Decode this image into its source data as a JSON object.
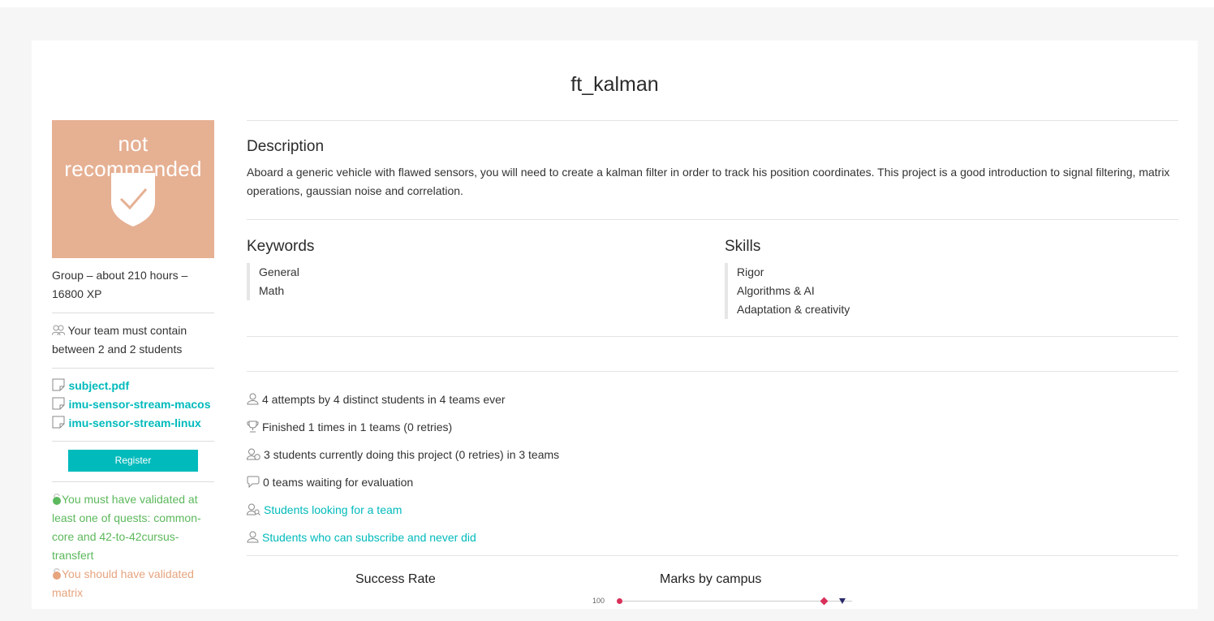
{
  "project": {
    "title": "ft_kalman",
    "badge_label": "not recommended",
    "meta": "Group – about 210 hours – 16800 XP",
    "team_text": "Your team must contain between 2 and 2 students",
    "attachments": [
      "subject.pdf",
      "imu-sensor-stream-macos",
      "imu-sensor-stream-linux"
    ],
    "register_label": "Register",
    "requirements": [
      {
        "text": "You must have validated at least one of quests: common-core and 42-to-42cursus-transfert",
        "status": "ok"
      },
      {
        "text": "You should have validated matrix",
        "status": "warn"
      }
    ]
  },
  "description": {
    "heading": "Description",
    "text": "Aboard a generic vehicle with flawed sensors, you will need to create a kalman filter in order to track his position coordinates. This project is a good introduction to signal filtering, matrix operations, gaussian noise and correlation."
  },
  "keywords": {
    "heading": "Keywords",
    "items": [
      "General",
      "Math"
    ]
  },
  "skills": {
    "heading": "Skills",
    "items": [
      "Rigor",
      "Algorithms & AI",
      "Adaptation & creativity"
    ]
  },
  "stats": [
    {
      "icon": "user-icon",
      "text": "4 attempts by 4 distinct students in 4 teams ever",
      "link": false
    },
    {
      "icon": "trophy-icon",
      "text": "Finished 1 times in 1 teams (0 retries)",
      "link": false
    },
    {
      "icon": "user-clock-icon",
      "text": "3 students currently doing this project (0 retries) in 3 teams",
      "link": false
    },
    {
      "icon": "chat-icon",
      "text": "0 teams waiting for evaluation",
      "link": false
    },
    {
      "icon": "user-search-icon",
      "text": "Students looking for a team",
      "link": true
    },
    {
      "icon": "user-icon",
      "text": "Students who can subscribe and never did",
      "link": true
    }
  ],
  "charts": {
    "success_title": "Success Rate",
    "marks_title": "Marks by campus",
    "marks_tick": "100"
  },
  "colors": {
    "accent": "#00babc",
    "badge": "#e6b093",
    "ok": "#5cb85c",
    "warn": "#e6a47e"
  }
}
